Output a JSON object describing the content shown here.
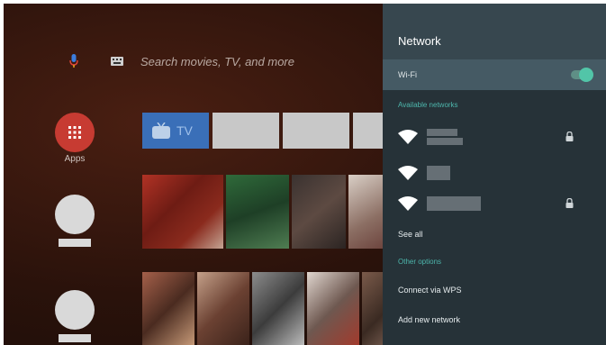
{
  "search": {
    "placeholder": "Search movies, TV, and more"
  },
  "apps": {
    "label": "Apps"
  },
  "tv_tile": {
    "label": "TV"
  },
  "panel": {
    "title": "Network",
    "wifi_label": "Wi-Fi",
    "wifi_enabled": true,
    "available_title": "Available networks",
    "see_all": "See all",
    "other_title": "Other options",
    "connect_wps": "Connect via WPS",
    "add_network": "Add new network"
  },
  "colors": {
    "accent": "#4db6ac",
    "panel_bg": "#263238",
    "header_bg": "#37474f",
    "apps_red": "#c73b32"
  },
  "icons": {
    "mic": "mic-icon",
    "keyboard": "keyboard-icon",
    "apps": "apps-grid-icon",
    "wifi": "wifi-icon",
    "lock": "lock-icon"
  }
}
